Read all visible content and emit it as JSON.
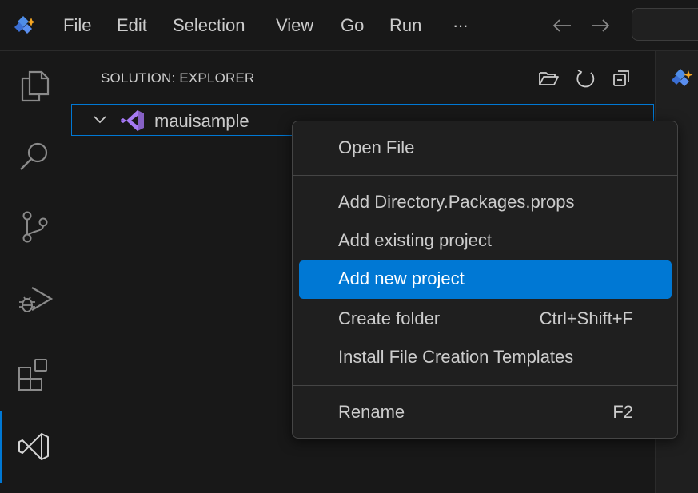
{
  "titlebar": {
    "menu": [
      "File",
      "Edit",
      "Selection",
      "View",
      "Go",
      "Run",
      "···"
    ],
    "back_icon": "arrow-left-icon",
    "forward_icon": "arrow-right-icon"
  },
  "activitybar": {
    "items": [
      "explorer-icon",
      "search-icon",
      "source-control-icon",
      "run-debug-icon",
      "extensions-icon",
      "visual-studio-icon"
    ],
    "active": "visual-studio-icon",
    "accent": "#0078d4"
  },
  "sidebar": {
    "title": "SOLUTION: EXPLORER",
    "actions": [
      "open-folder-icon",
      "refresh-icon",
      "collapse-all-icon"
    ],
    "tree": [
      {
        "label": "mauisample",
        "icon": "visual-studio-icon",
        "expanded": true
      }
    ]
  },
  "context_menu": {
    "groups": [
      [
        {
          "label": "Open File",
          "shortcut": ""
        }
      ],
      [
        {
          "label": "Add Directory.Packages.props",
          "shortcut": ""
        },
        {
          "label": "Add existing project",
          "shortcut": ""
        },
        {
          "label": "Add new project",
          "shortcut": "",
          "highlighted": true
        },
        {
          "label": "Create folder",
          "shortcut": "Ctrl+Shift+F"
        },
        {
          "label": "Install File Creation Templates",
          "shortcut": ""
        }
      ],
      [
        {
          "label": "Rename",
          "shortcut": "F2"
        }
      ]
    ],
    "highlight_color": "#0078d4"
  },
  "colors": {
    "background": "#181818",
    "menu_background": "#1f1f1f",
    "text": "#cccccc",
    "accent": "#0078d4",
    "vs_purple": "#8661c5"
  }
}
